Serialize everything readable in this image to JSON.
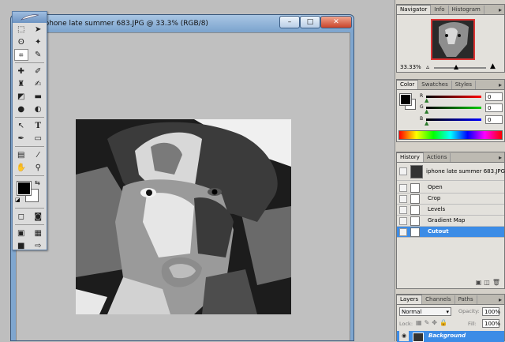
{
  "document": {
    "title": "iphone late summer 683.JPG @ 33.3% (RGB/8)",
    "minimize": "–",
    "maximize": "□",
    "close": "✕"
  },
  "toolbox": {
    "tools": [
      [
        "marquee-icon",
        "move-icon"
      ],
      [
        "lasso-icon",
        "magic-wand-icon"
      ],
      [
        "crop-icon",
        "slice-icon"
      ],
      [
        "healing-brush-icon",
        "brush-icon"
      ],
      [
        "clone-stamp-icon",
        "history-brush-icon"
      ],
      [
        "eraser-icon",
        "gradient-icon"
      ],
      [
        "blur-icon",
        "dodge-icon"
      ],
      [
        "path-select-icon",
        "type-icon"
      ],
      [
        "pen-icon",
        "shape-icon"
      ],
      [
        "notes-icon",
        "eyedropper-icon"
      ],
      [
        "hand-icon",
        "zoom-icon"
      ]
    ],
    "foreground": "#000000",
    "background": "#ffffff"
  },
  "navigator": {
    "tabs": [
      "Navigator",
      "Info",
      "Histogram"
    ],
    "zoom": "33.33%"
  },
  "color": {
    "tabs": [
      "Color",
      "Swatches",
      "Styles"
    ],
    "channels": [
      {
        "label": "R",
        "value": "0"
      },
      {
        "label": "G",
        "value": "0"
      },
      {
        "label": "B",
        "value": "0"
      }
    ]
  },
  "history": {
    "tabs": [
      "History",
      "Actions"
    ],
    "snapshot": "iphone late summer 683.JPG",
    "states": [
      "Open",
      "Crop",
      "Levels",
      "Gradient Map",
      "Cutout"
    ],
    "selected": "Cutout"
  },
  "layers": {
    "tabs": [
      "Layers",
      "Channels",
      "Paths"
    ],
    "blend_mode": "Normal",
    "opacity_label": "Opacity:",
    "opacity": "100%",
    "lock_label": "Lock:",
    "fill_label": "Fill:",
    "fill": "100%",
    "layer_name": "Background"
  },
  "colors": {
    "accent": "#3c8ce6",
    "title_bar": "#7fa6cf"
  }
}
